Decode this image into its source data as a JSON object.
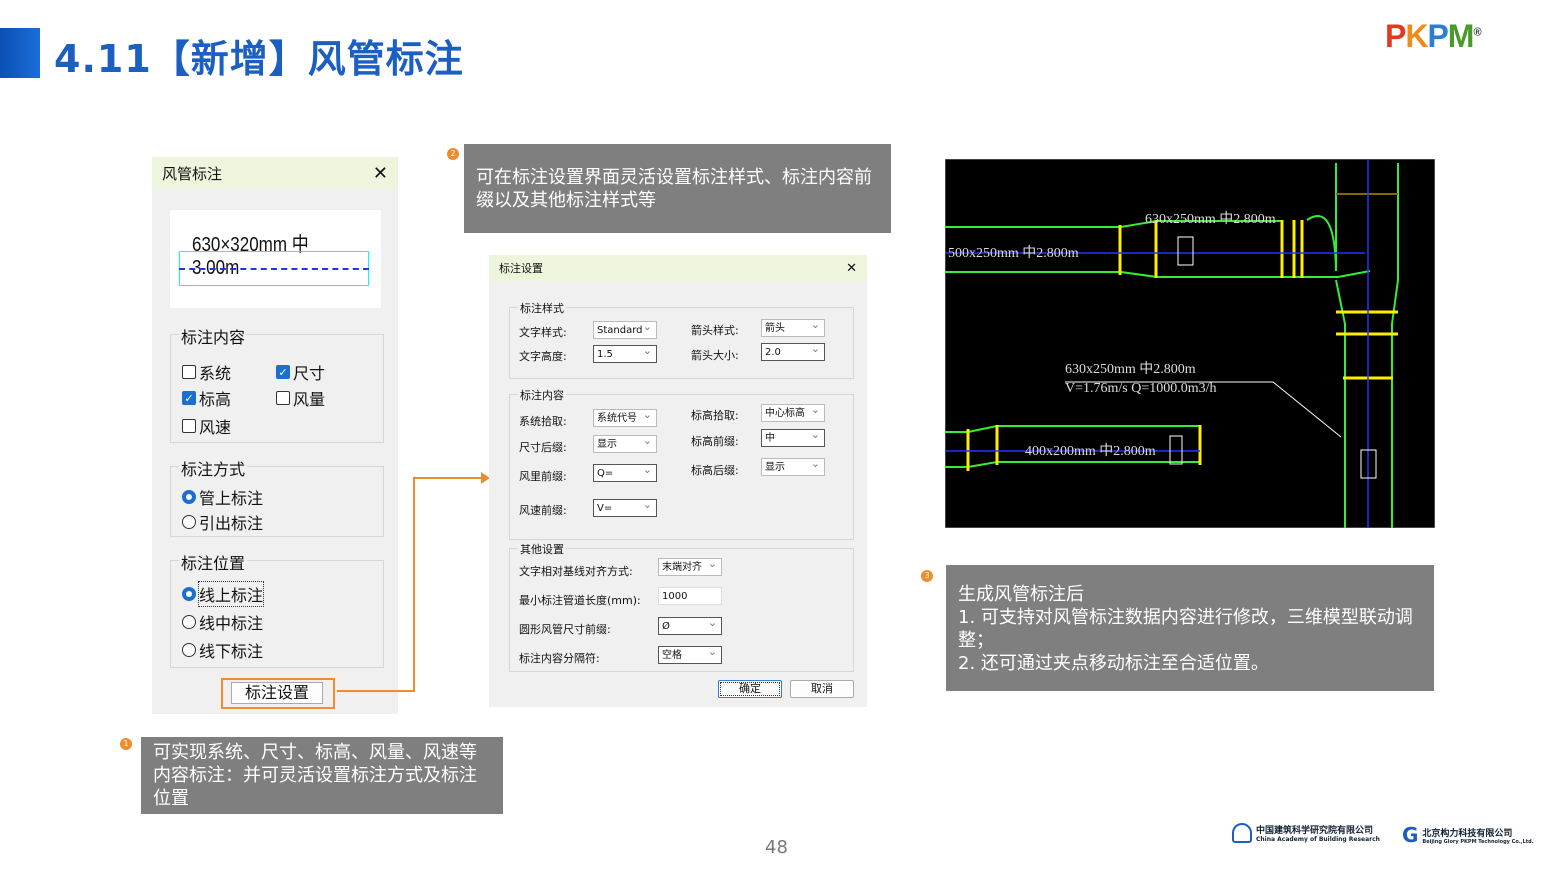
{
  "slide": {
    "title": "4.11【新增】风管标注",
    "page": "48",
    "logo": "PKPM",
    "colors": {
      "accent": "#1c5fc2",
      "note_bg": "#7f7f7f",
      "marker": "#f08c30"
    }
  },
  "dialog1": {
    "title": "风管标注",
    "preview": "630×320mm 中3.00m",
    "content_group": "标注内容",
    "content_items": [
      {
        "label": "系统",
        "checked": false
      },
      {
        "label": "尺寸",
        "checked": true
      },
      {
        "label": "标高",
        "checked": true
      },
      {
        "label": "风量",
        "checked": false
      },
      {
        "label": "风速",
        "checked": false
      }
    ],
    "mode_group": "标注方式",
    "modes": [
      {
        "label": "管上标注",
        "selected": true
      },
      {
        "label": "引出标注",
        "selected": false
      }
    ],
    "pos_group": "标注位置",
    "positions": [
      {
        "label": "线上标注",
        "selected": true
      },
      {
        "label": "线中标注",
        "selected": false
      },
      {
        "label": "线下标注",
        "selected": false
      }
    ],
    "settings_button": "标注设置"
  },
  "dialog2": {
    "title": "标注设置",
    "style_group": "标注样式",
    "text_style_label": "文字样式:",
    "text_style": "Standard",
    "text_height_label": "文字高度:",
    "text_height": "1.5",
    "arrow_style_label": "箭头样式:",
    "arrow_style": "箭头",
    "arrow_size_label": "箭头大小:",
    "arrow_size": "2.0",
    "content_group": "标注内容",
    "sys_label": "系统拾取:",
    "sys": "系统代号",
    "size_suffix_label": "尺寸后缀:",
    "size_suffix": "显示",
    "flow_prefix_label": "风里前缀:",
    "flow_prefix": "Q=",
    "speed_prefix_label": "风速前缀:",
    "speed_prefix": "V=",
    "elev_pick_label": "标高拾取:",
    "elev_pick": "中心标高",
    "elev_prefix_label": "标高前缀:",
    "elev_prefix": "中",
    "elev_suffix_label": "标高后缀:",
    "elev_suffix": "显示",
    "other_group": "其他设置",
    "align_label": "文字相对基线对齐方式:",
    "align": "末端对齐",
    "minlen_label": "最小标注管道长度(mm):",
    "minlen": "1000",
    "round_prefix_label": "圆形风管尺寸前缀:",
    "round_prefix": "Ø",
    "sep_label": "标注内容分隔符:",
    "sep": "空格",
    "ok": "确定",
    "cancel": "取消"
  },
  "cad": {
    "label1": "630x250mm 中2.800m",
    "label2": "500x250mm 中2.800m",
    "label3a": "630x250mm 中2.800m",
    "label3b": "V=1.76m/s Q=1000.0m3/h",
    "label4": "400x200mm 中2.800m"
  },
  "notes": [
    {
      "num": "1",
      "text": "可实现系统、尺寸、标高、风量、风速等内容标注：并可灵活设置标注方式及标注位置"
    },
    {
      "num": "2",
      "text": "可在标注设置界面灵活设置标注样式、标注内容前缀以及其他标注样式等"
    },
    {
      "num": "3",
      "title": "生成风管标注后",
      "line1": "1. 可支持对风管标注数据内容进行修改，三维模型联动调整；",
      "line2": "2. 还可通过夹点移动标注至合适位置。"
    }
  ],
  "footer": {
    "org1_cn": "中国建筑科学研究院有限公司",
    "org1_en": "China Academy of Building Research",
    "org2_cn": "北京构力科技有限公司",
    "org2_en": "Beijing Glory PKPM Technology Co.,Ltd."
  }
}
